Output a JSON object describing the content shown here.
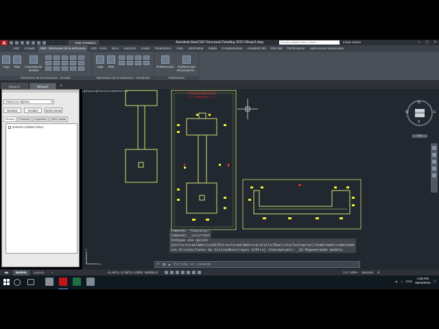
{
  "app": {
    "logo_letter": "A",
    "workspace": "ASD Armadura",
    "window_title": "Autodesk AutoCAD Structural Detailing 2015   Dibujo3.dwg",
    "search_placeholder": "Escriba palabra clave o frase",
    "signin": "Iniciar sesión"
  },
  "ribbon": {
    "tabs": [
      "ASD",
      "Armado",
      "ASD - Elementos de la estructura",
      "ASD - Inicio",
      "Inicio",
      "Inserción",
      "Anotar",
      "Paramétrico",
      "Vista",
      "Administrar",
      "Salida",
      "Complementos",
      "Autodesk 360",
      "BIM 360",
      "Performance",
      "Aplicaciones destacadas"
    ],
    "active_tab_index": 2,
    "groups": [
      {
        "label": "Elementos de la estructura - armado",
        "buttons": [
          "Viga",
          "Pilar",
          "Cimentación aislada"
        ]
      },
      {
        "label": "Elementos de la estructura - encofrado",
        "buttons": [
          "Viga",
          "Pilar"
        ]
      },
      {
        "label": "Parámetros",
        "buttons": [
          "Preferencias",
          "Preferencias del proyecto..."
        ]
      }
    ]
  },
  "doc_tabs": [
    "Dibujo1*",
    "Dibujo3*"
  ],
  "active_doc": 1,
  "browser": {
    "filter": "Todos los objetos",
    "buttons": [
      "Mostrar",
      "Ocultar",
      "Seleccionar"
    ],
    "tabs": [
      "Modelo",
      "Posición",
      "Impresión",
      "ASD Cadas"
    ],
    "tree": [
      "ZAPATA CONECTADA"
    ]
  },
  "viewport": {
    "label": "[-][Superior][Estructura alámbrica 2D]",
    "drawing_title": "ZAPATA CONECTADA",
    "drawing_subtitle": "Escala 1:50"
  },
  "viewcube": {
    "north": "N",
    "south": "S",
    "east": "E",
    "west": "W",
    "face": "SUPERIOR",
    "wcs": "SCU"
  },
  "command": {
    "history": [
      "Comando: *Cancelar*",
      "Comando: _vscurrent",
      "Indique una opción [estructuraalámbrica2d/Estructuraalámbrica/oCulto/Realista/Conceptual/Sombreado/sombreado con Aristas/tonos de Gris/esBozo/rayos X/Otro] <Conceptual>: _2d Regenerando modelo."
    ],
    "placeholder": "Escriba un comando"
  },
  "layouts": [
    "Modelo",
    "Layout1"
  ],
  "status": {
    "coords": "41.9474, 17.3873, 0.0000",
    "mode": "MODELO",
    "scale": "1:1 / 100%",
    "units": "Decimal"
  },
  "taskbar": {
    "lang": "ENG",
    "time": "2:00 PM",
    "date": "06/10/2015"
  },
  "colors": {
    "viewport_bg": "#212830",
    "drawing_line": "#d7e070",
    "marker": "#f2f230",
    "red_annotation": "#ff3030",
    "accent": "#c3161c"
  }
}
